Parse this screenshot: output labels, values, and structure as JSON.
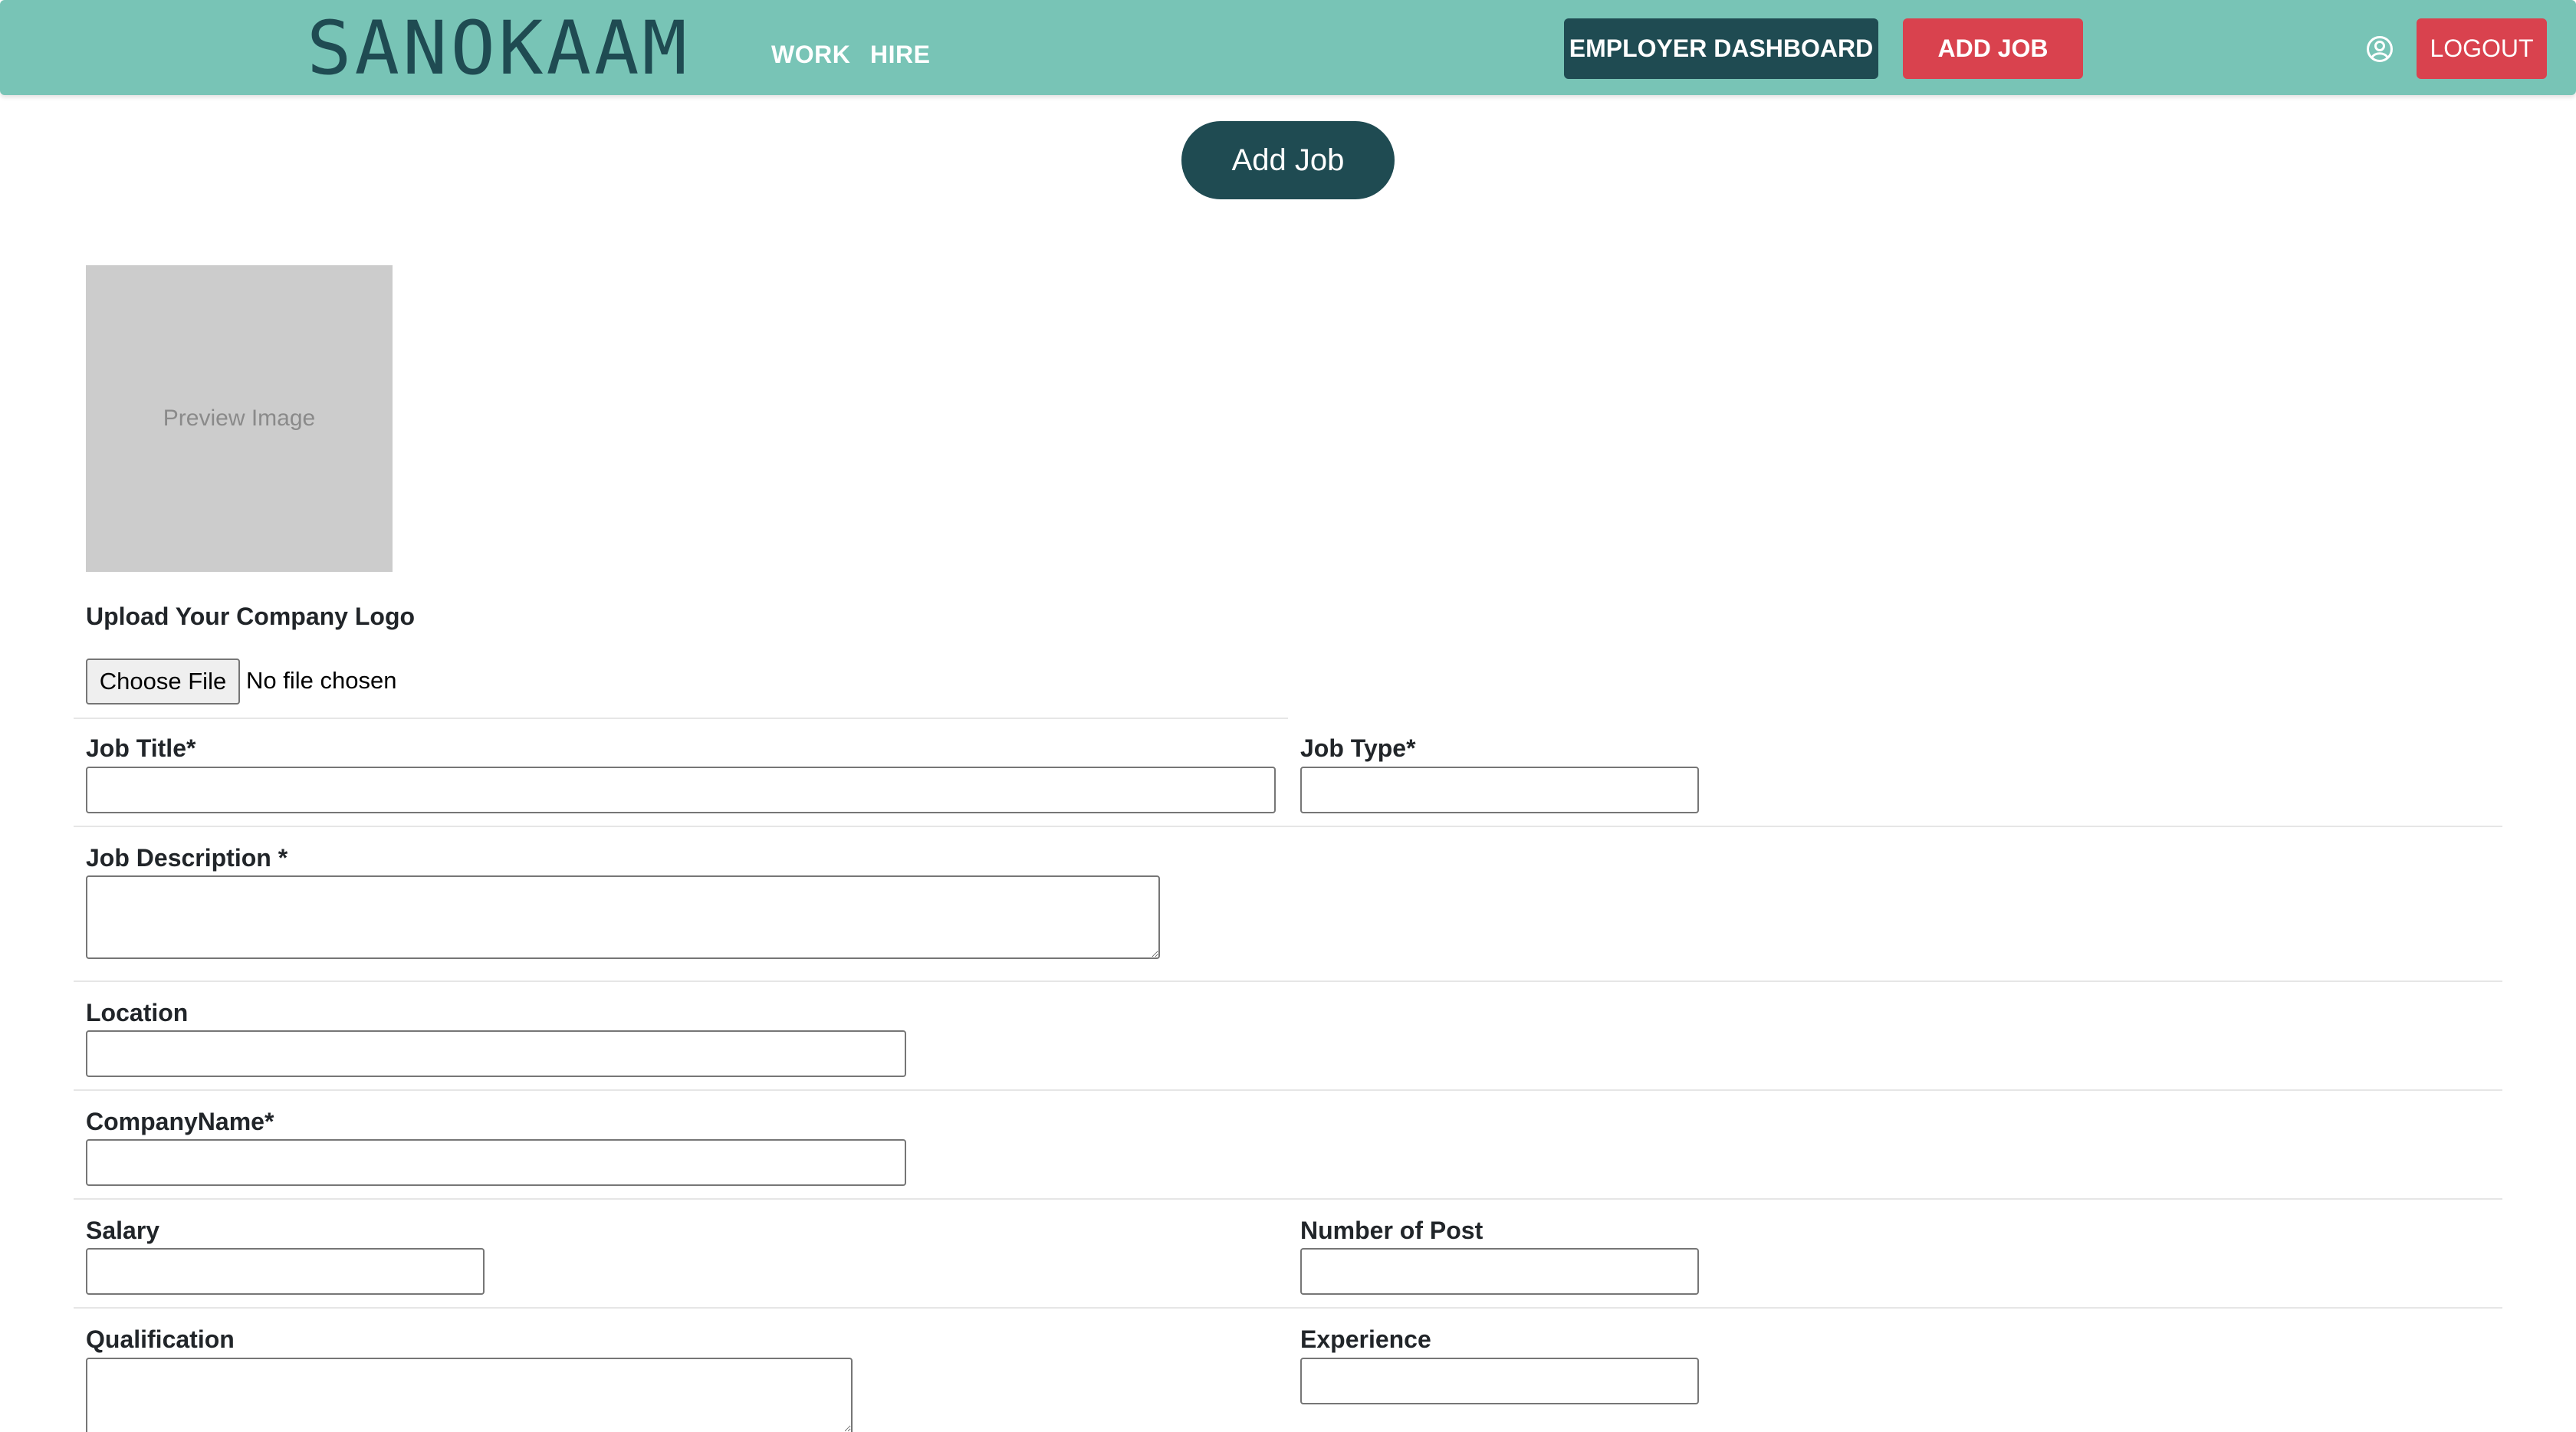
{
  "navbar": {
    "brand": "SANOKAAM",
    "links": [
      "WORK",
      "HIRE"
    ],
    "employer_dashboard": "EMPLOYER DASHBOARD",
    "add_job": "ADD JOB",
    "logout": "LOGOUT",
    "user_icon": "user-circle-icon",
    "colors": {
      "bar": "#78c4b6",
      "dark": "#1f4b52",
      "red": "#d9424e"
    }
  },
  "page": {
    "title": "Add Job"
  },
  "logo_upload": {
    "preview_text": "Preview Image",
    "label": "Upload Your Company Logo",
    "button": "Choose File",
    "status": "No file chosen"
  },
  "form": {
    "job_title": {
      "label": "Job Title*",
      "value": ""
    },
    "job_type": {
      "label": "Job Type*",
      "value": ""
    },
    "job_description": {
      "label": "Job Description *",
      "value": ""
    },
    "location": {
      "label": "Location",
      "value": ""
    },
    "company_name": {
      "label": "CompanyName*",
      "value": ""
    },
    "salary": {
      "label": "Salary",
      "value": ""
    },
    "number_of_post": {
      "label": "Number of Post",
      "value": ""
    },
    "qualification": {
      "label": "Qualification",
      "value": ""
    },
    "experience": {
      "label": "Experience",
      "value": ""
    }
  }
}
